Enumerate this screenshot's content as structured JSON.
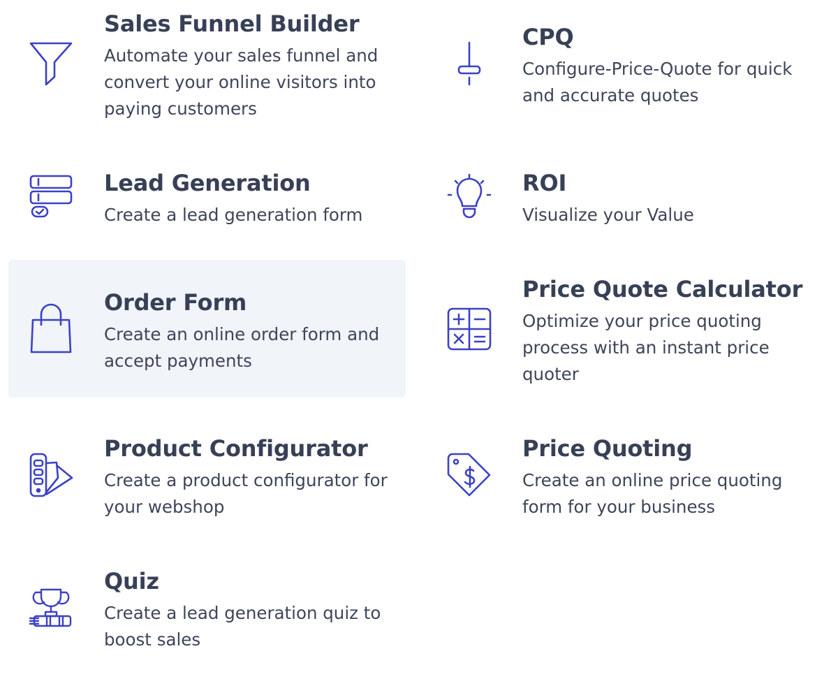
{
  "colors": {
    "icon": "#3b41c5",
    "title": "#374056",
    "text": "#3e4559",
    "active_bg": "#f1f4f9"
  },
  "items": [
    {
      "id": "sales-funnel-builder",
      "icon": "funnel-icon",
      "title": "Sales Funnel Builder",
      "desc": [
        "Automate your sales funnel and",
        "convert your online visitors into",
        "paying customers"
      ]
    },
    {
      "id": "cpq",
      "icon": "slider-icon",
      "title": "CPQ",
      "desc": [
        "Configure-Price-Quote for quick",
        "and accurate quotes"
      ]
    },
    {
      "id": "lead-generation",
      "icon": "form-icon",
      "title": "Lead Generation",
      "desc": [
        "Create a lead generation form"
      ]
    },
    {
      "id": "roi",
      "icon": "lightbulb-icon",
      "title": "ROI",
      "desc": [
        "Visualize your Value"
      ]
    },
    {
      "id": "order-form",
      "icon": "shopping-bag-icon",
      "title": "Order Form",
      "desc": [
        "Create an online order form and",
        "accept payments"
      ]
    },
    {
      "id": "price-quote-calculator",
      "icon": "calculator-icon",
      "title": "Price Quote Calculator",
      "desc": [
        "Optimize your price quoting",
        "process with an instant price",
        "quoter"
      ]
    },
    {
      "id": "product-configurator",
      "icon": "color-swatch-icon",
      "title": "Product Configurator",
      "desc": [
        "Create a product configurator for",
        "your webshop"
      ]
    },
    {
      "id": "price-quoting",
      "icon": "price-tag-icon",
      "title": "Price Quoting",
      "desc": [
        "Create an online price quoting",
        "form for your business"
      ]
    },
    {
      "id": "quiz",
      "icon": "trophy-icon",
      "title": "Quiz",
      "desc": [
        "Create a lead generation quiz to",
        "boost sales"
      ]
    }
  ]
}
